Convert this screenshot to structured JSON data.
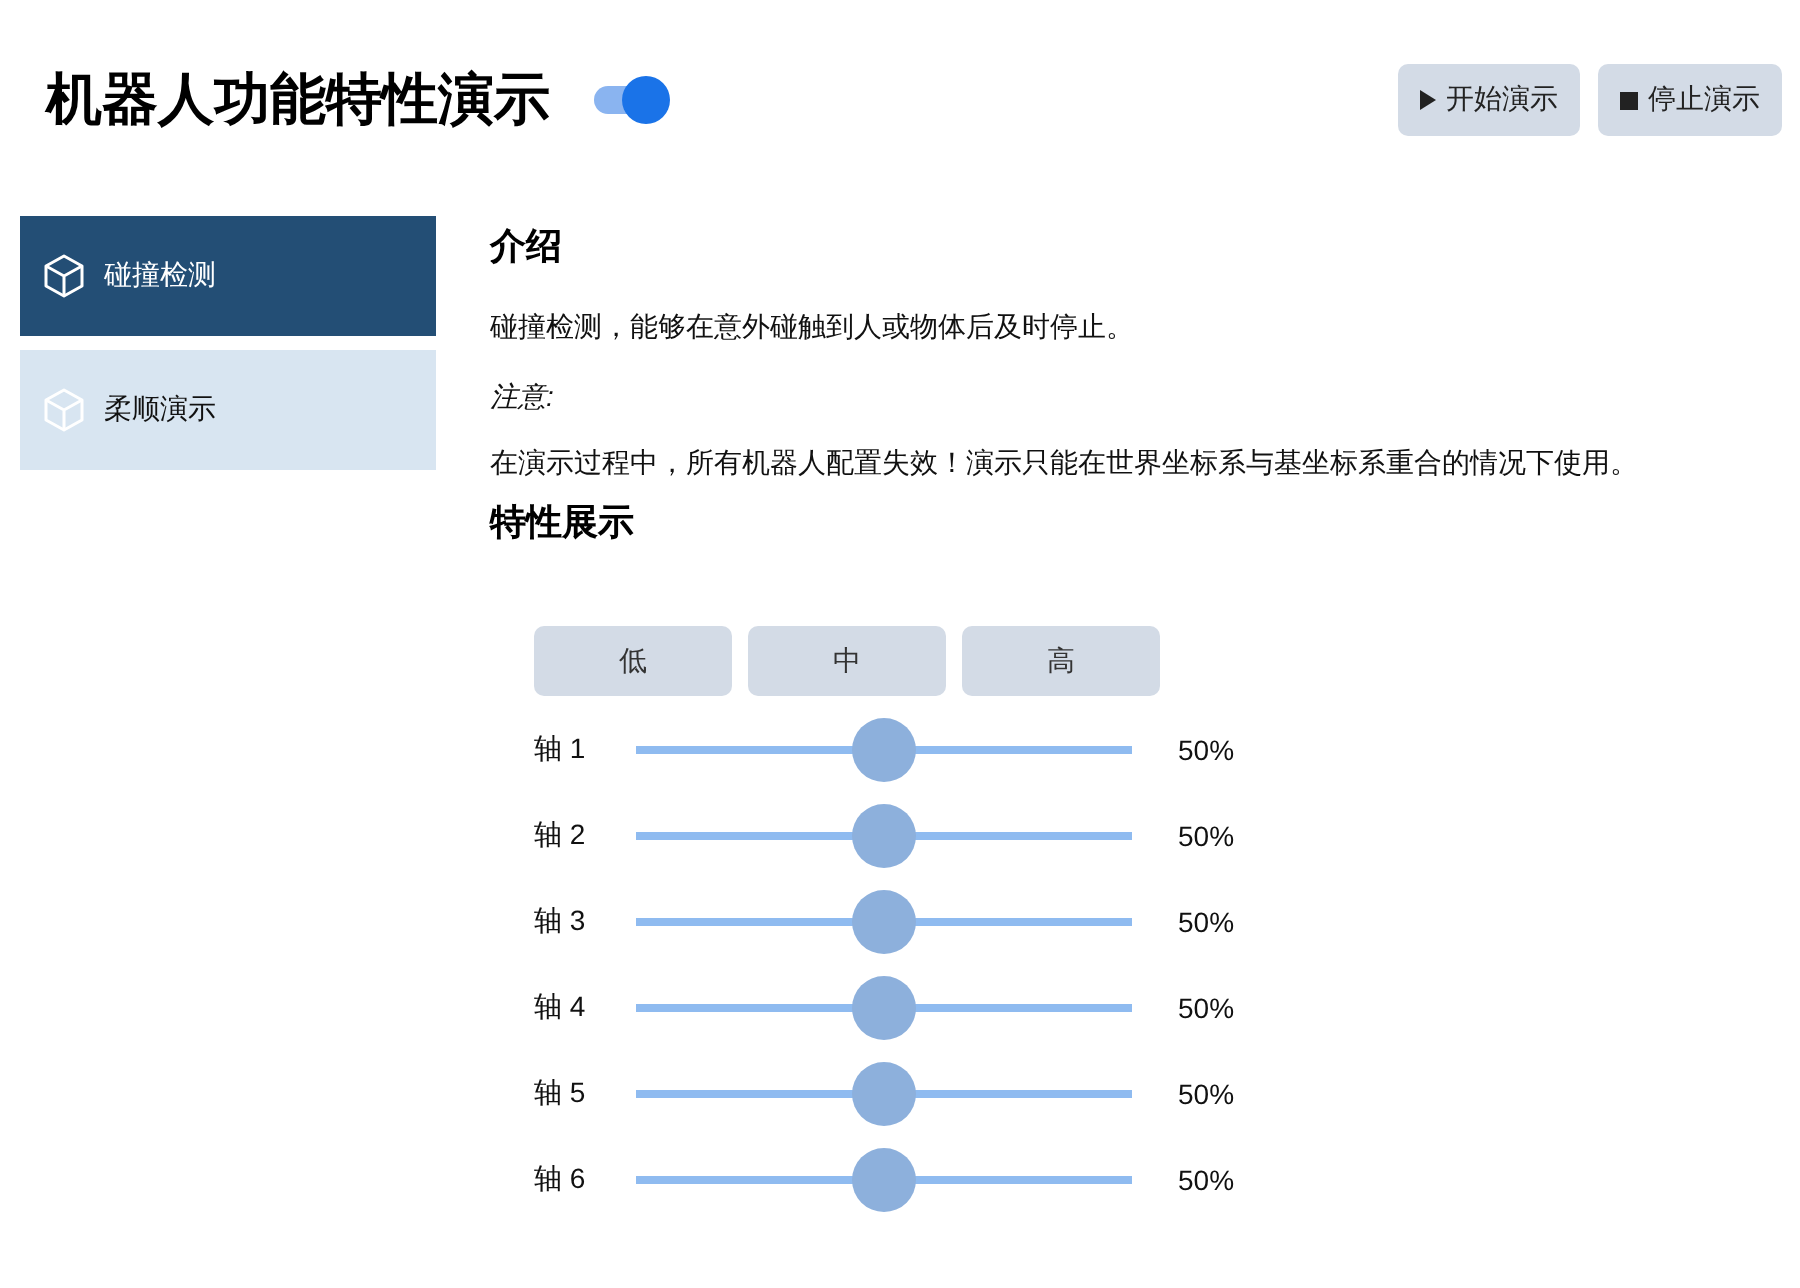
{
  "header": {
    "title": "机器人功能特性演示",
    "toggle": {
      "on": true
    },
    "buttons": [
      {
        "kind": "play",
        "label": "开始演示"
      },
      {
        "kind": "stop",
        "label": "停止演示"
      }
    ]
  },
  "sidebar": {
    "items": [
      {
        "label": "碰撞检测",
        "selected": true
      },
      {
        "label": "柔顺演示",
        "selected": false
      }
    ]
  },
  "intro": {
    "heading": "介绍",
    "description": "碰撞检测，能够在意外碰触到人或物体后及时停止。",
    "note_label": "注意:",
    "note": "在演示过程中，所有机器人配置失效！演示只能在世界坐标系与基坐标系重合的情况下使用。"
  },
  "features": {
    "heading": "特性展示",
    "level_buttons": [
      "低",
      "中",
      "高"
    ],
    "axes": [
      {
        "label": "轴 1",
        "level": 0.5,
        "reading": "50%"
      },
      {
        "label": "轴 2",
        "level": 0.5,
        "reading": "50%"
      },
      {
        "label": "轴 3",
        "level": 0.5,
        "reading": "50%"
      },
      {
        "label": "轴 4",
        "level": 0.5,
        "reading": "50%"
      },
      {
        "label": "轴 5",
        "level": 0.5,
        "reading": "50%"
      },
      {
        "label": "轴 6",
        "level": 0.5,
        "reading": "50%"
      }
    ]
  }
}
